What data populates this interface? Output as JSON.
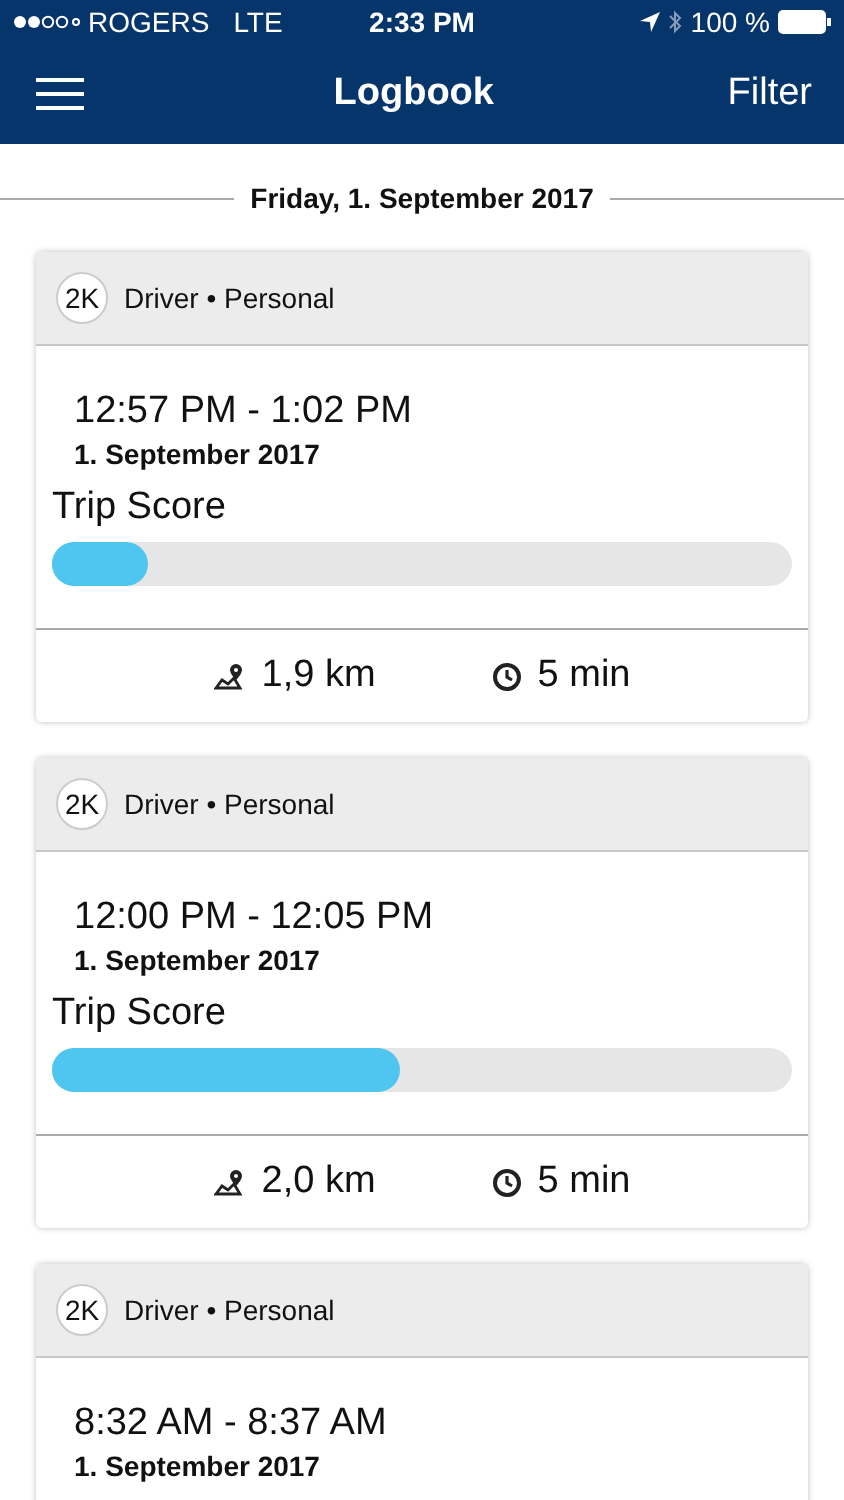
{
  "status_bar": {
    "carrier": "ROGERS",
    "network": "LTE",
    "time": "2:33 PM",
    "battery": "100 %"
  },
  "nav": {
    "title": "Logbook",
    "action": "Filter"
  },
  "date_header": "Friday, 1. September 2017",
  "trips": [
    {
      "badge": "2K",
      "role": "Driver • Personal",
      "time_range": "12:57 PM - 1:02 PM",
      "date": "1. September 2017",
      "score_label": "Trip Score",
      "level": 0.13,
      "distance": "1,9 km",
      "duration": "5 min"
    },
    {
      "badge": "2K",
      "role": "Driver • Personal",
      "time_range": "12:00 PM - 12:05 PM",
      "date": "1. September 2017",
      "score_label": "Trip Score",
      "level": 0.47,
      "distance": "2,0 km",
      "duration": "5 min"
    },
    {
      "badge": "2K",
      "role": "Driver • Personal",
      "time_range": "8:32 AM - 8:37 AM",
      "date": "1. September 2017"
    }
  ]
}
